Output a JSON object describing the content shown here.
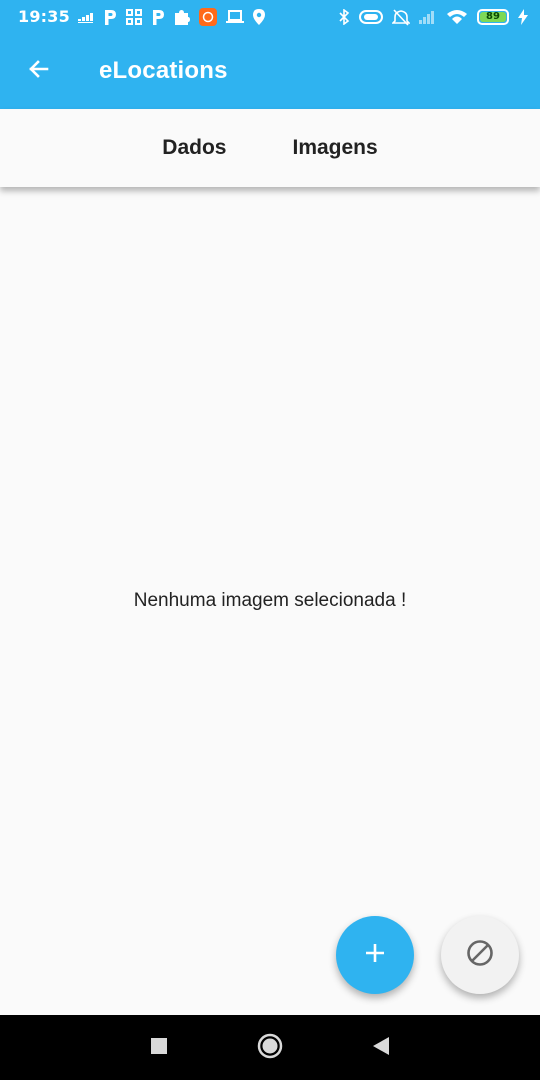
{
  "status_bar": {
    "time": "19:35",
    "battery_level": "89",
    "left_icons": [
      "signal-bars-icon",
      "parking-icon",
      "grid-app-icon",
      "parking-icon",
      "puzzle-icon",
      "orange-app-icon",
      "laptop-icon",
      "location-pin-icon"
    ],
    "right_icons": [
      "bluetooth-icon",
      "vibrate-icon",
      "alarm-off-icon",
      "cell-signal-icon",
      "wifi-icon",
      "battery-icon",
      "charging-bolt-icon"
    ]
  },
  "app_bar": {
    "title": "eLocations",
    "back_icon": "arrow-back-icon"
  },
  "tabs": [
    {
      "label": "Dados"
    },
    {
      "label": "Imagens"
    }
  ],
  "content": {
    "empty_message": "Nenhuma imagem selecionada !"
  },
  "fabs": {
    "add_icon": "plus-icon",
    "cancel_icon": "block-icon"
  },
  "colors": {
    "primary": "#2fb3f0",
    "background": "#fafafa",
    "text": "#222222",
    "nav_bar": "#000000"
  }
}
